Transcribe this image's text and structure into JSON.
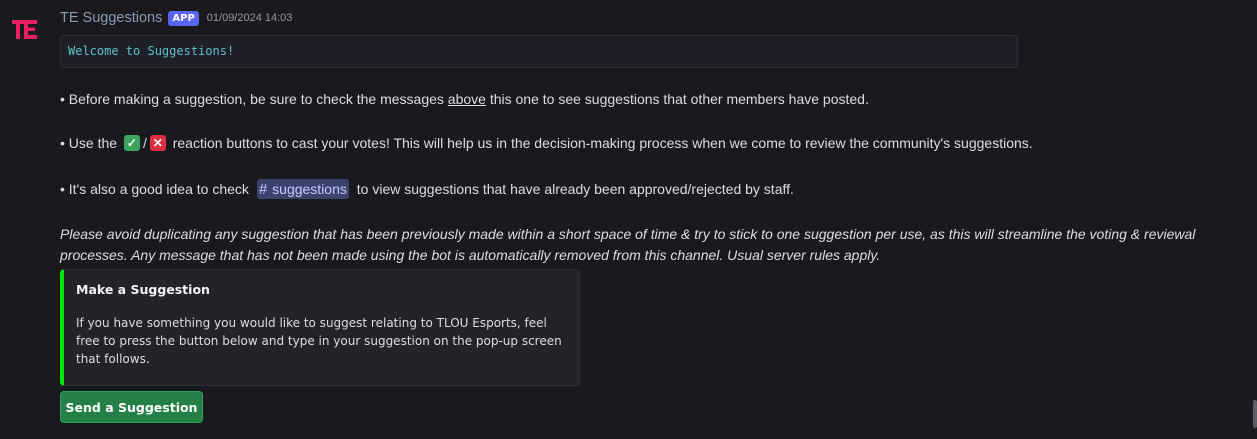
{
  "header": {
    "username": "TE Suggestions",
    "badge": "APP",
    "timestamp": "01/09/2024 14:03"
  },
  "avatar": {
    "text": "TE",
    "color": "#e91e63"
  },
  "codeblock": {
    "text": "Welcome to Suggestions!"
  },
  "lines": {
    "line1": {
      "before": "• Before making a suggestion, be sure to check the messages ",
      "link": "above",
      "after": " this one to see suggestions that other members have posted."
    },
    "line2": {
      "before": "• Use the ",
      "slash": "/",
      "after": " reaction buttons to cast your votes! This will help us in the decision-making process when we come to review the community's suggestions."
    },
    "line3": {
      "before": "• It's also a good idea to check ",
      "channel": "suggestions",
      "after": " to view suggestions that have already been approved/rejected by staff."
    }
  },
  "italic_note": "Please avoid duplicating any suggestion that has been previously made within a short space of time & try to stick to one suggestion per use, as this will streamline the voting & reviewal processes. Any message that has not been made using the bot is automatically removed from this channel. Usual server rules apply.",
  "embed": {
    "title": "Make a Suggestion",
    "description": "If you have something you would like to suggest relating to TLOU Esports, feel free to press the button below and type in your suggestion on the pop-up screen that follows.",
    "accent_color": "#00e600"
  },
  "button": {
    "label": "Send a Suggestion"
  }
}
